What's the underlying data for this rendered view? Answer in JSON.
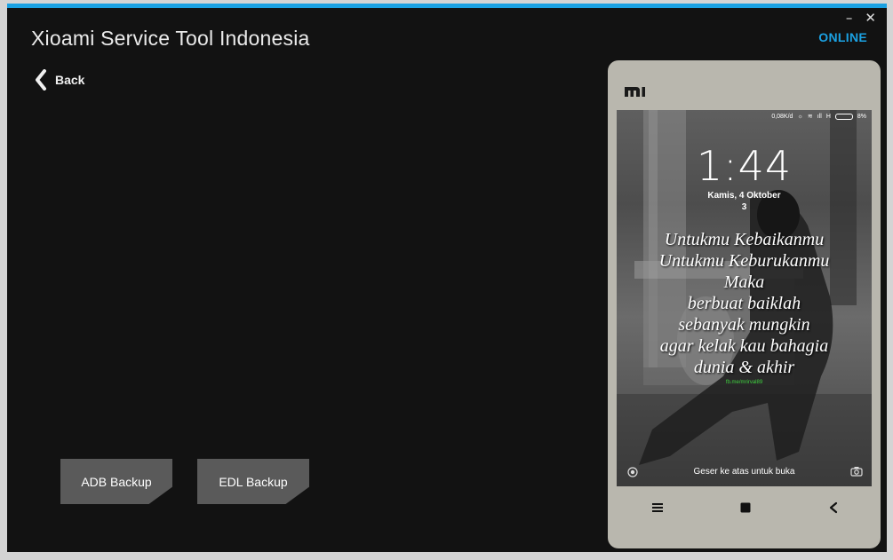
{
  "app": {
    "title": "Xioami Service Tool Indonesia",
    "status": "ONLINE",
    "minimize_label": "–",
    "close_label": "✕",
    "accent_color": "#1ba1e2"
  },
  "nav": {
    "back_label": "Back",
    "back_icon": "chevron-left-icon"
  },
  "actions": {
    "adb_label": "ADB Backup",
    "edl_label": "EDL Backup"
  },
  "phone": {
    "statusbar": {
      "speed": "0,08K/d",
      "network": "H",
      "battery": "8%"
    },
    "clock": "1:44",
    "date": "Kamis, 4 Oktober",
    "date_extra": "3",
    "quote": [
      "Untukmu Kebaikanmu",
      "Untukmu Keburukanmu",
      "Maka",
      "berbuat baiklah",
      "sebanyak mungkin",
      "agar kelak kau bahagia",
      "dunia & akhir"
    ],
    "quote_link": "fb.me/mrirval89",
    "unlock_hint": "Geser ke atas untuk buka",
    "navbar_icons": [
      "menu-icon",
      "home-icon",
      "back-icon"
    ]
  }
}
